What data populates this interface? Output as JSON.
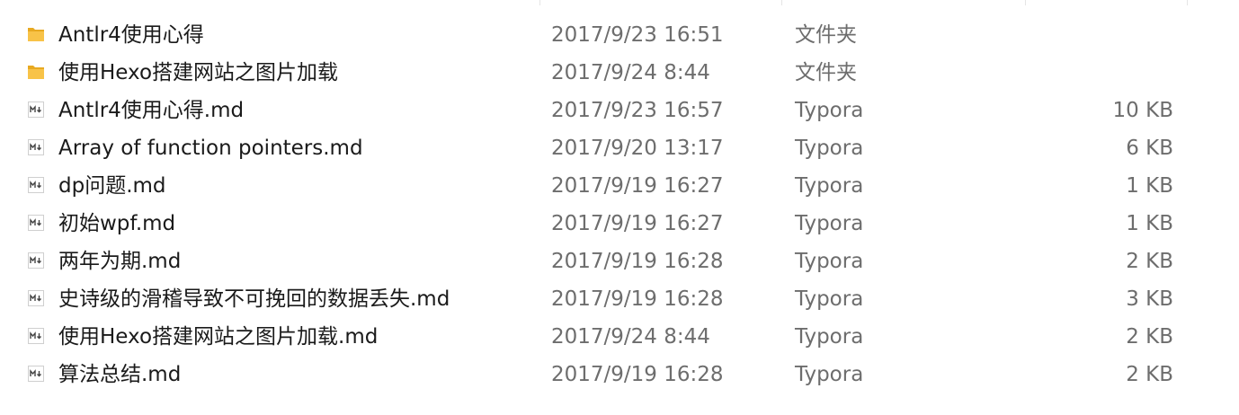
{
  "files": [
    {
      "name": "Antlr4使用心得",
      "date": "2017/9/23 16:51",
      "type": "文件夹",
      "size": "",
      "icon": "folder-icon"
    },
    {
      "name": "使用Hexo搭建网站之图片加载",
      "date": "2017/9/24 8:44",
      "type": "文件夹",
      "size": "",
      "icon": "folder-icon"
    },
    {
      "name": "Antlr4使用心得.md",
      "date": "2017/9/23 16:57",
      "type": "Typora",
      "size": "10 KB",
      "icon": "markdown-file-icon"
    },
    {
      "name": "Array of function pointers.md",
      "date": "2017/9/20 13:17",
      "type": "Typora",
      "size": "6 KB",
      "icon": "markdown-file-icon"
    },
    {
      "name": "dp问题.md",
      "date": "2017/9/19 16:27",
      "type": "Typora",
      "size": "1 KB",
      "icon": "markdown-file-icon"
    },
    {
      "name": "初始wpf.md",
      "date": "2017/9/19 16:27",
      "type": "Typora",
      "size": "1 KB",
      "icon": "markdown-file-icon"
    },
    {
      "name": "两年为期.md",
      "date": "2017/9/19 16:28",
      "type": "Typora",
      "size": "2 KB",
      "icon": "markdown-file-icon"
    },
    {
      "name": "史诗级的滑稽导致不可挽回的数据丢失.md",
      "date": "2017/9/19 16:28",
      "type": "Typora",
      "size": "3 KB",
      "icon": "markdown-file-icon"
    },
    {
      "name": "使用Hexo搭建网站之图片加载.md",
      "date": "2017/9/24 8:44",
      "type": "Typora",
      "size": "2 KB",
      "icon": "markdown-file-icon"
    },
    {
      "name": "算法总结.md",
      "date": "2017/9/19 16:28",
      "type": "Typora",
      "size": "2 KB",
      "icon": "markdown-file-icon"
    }
  ],
  "colors": {
    "folder": "#f8c348",
    "folder_dark": "#e8a921",
    "text_primary": "#1a1a1a",
    "text_secondary": "#6d6d6d"
  }
}
